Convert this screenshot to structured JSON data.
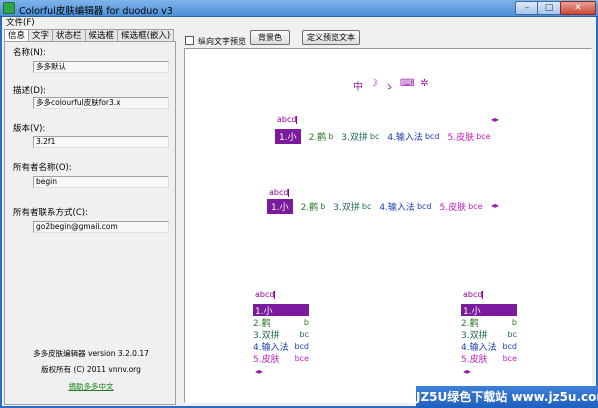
{
  "window": {
    "title": "Colorful皮肤编辑器 for duoduo v3",
    "minimize": "–",
    "maximize": "□",
    "close": "✕"
  },
  "menu": {
    "file": "文件(F)"
  },
  "tabs": [
    "信息",
    "文字",
    "状态栏",
    "候选框",
    "候选框(嵌入)"
  ],
  "info": {
    "name_label": "名称(N):",
    "name_value": "多多默认",
    "desc_label": "描述(D):",
    "desc_value": "多多colourful皮肤for3.x",
    "version_label": "版本(V):",
    "version_value": "3.2f1",
    "owner_label": "所有者名称(O):",
    "owner_value": "begin",
    "contact_label": "所有者联系方式(C):",
    "contact_value": "go2begin@gmail.com"
  },
  "footer": {
    "app_version": "多多皮肤编辑器 version 3.2.0.17",
    "copyright": "版权所有 (C) 2011 vnnv.org",
    "donate": "捐助多多中文"
  },
  "toolbar": {
    "vertical_preview": "纵向文字预览",
    "background_color": "背景色",
    "custom_text": "定义预览文本"
  },
  "status_icons": [
    "中",
    "☽",
    "ゝ",
    "⌨",
    "✲"
  ],
  "preview": {
    "input_code": "abcd",
    "nav_arrows": "◂▸",
    "candidates": [
      {
        "label": "1.小",
        "code": ""
      },
      {
        "label": "2.鹳",
        "code": "b"
      },
      {
        "label": "3.双拼",
        "code": "bc"
      },
      {
        "label": "4.输入法",
        "code": "bcd"
      },
      {
        "label": "5.皮肤",
        "code": "bce"
      }
    ]
  },
  "colors": {
    "selected_bg": "#7b1a9c",
    "cand1": "#ffffff",
    "cand2": "#2b7a2b",
    "cand3": "#1e6b5a",
    "cand4": "#1a3fb5",
    "cand5": "#c21ec2",
    "code_color": "#8a0099"
  },
  "watermark": "JZ5U绿色下载站 www.jz5u.com"
}
